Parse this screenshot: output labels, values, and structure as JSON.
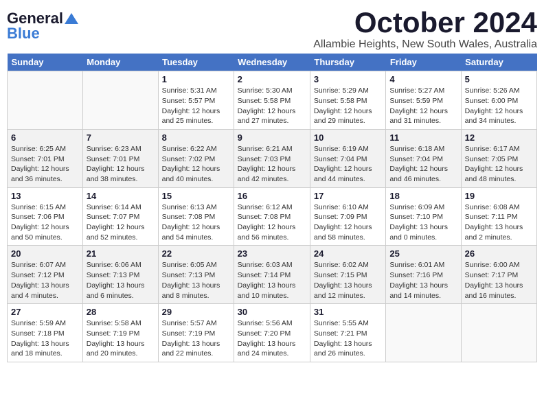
{
  "header": {
    "logo_general": "General",
    "logo_blue": "Blue",
    "month_title": "October 2024",
    "location": "Allambie Heights, New South Wales, Australia"
  },
  "calendar": {
    "days_of_week": [
      "Sunday",
      "Monday",
      "Tuesday",
      "Wednesday",
      "Thursday",
      "Friday",
      "Saturday"
    ],
    "weeks": [
      [
        {
          "day": "",
          "info": ""
        },
        {
          "day": "",
          "info": ""
        },
        {
          "day": "1",
          "info": "Sunrise: 5:31 AM\nSunset: 5:57 PM\nDaylight: 12 hours\nand 25 minutes."
        },
        {
          "day": "2",
          "info": "Sunrise: 5:30 AM\nSunset: 5:58 PM\nDaylight: 12 hours\nand 27 minutes."
        },
        {
          "day": "3",
          "info": "Sunrise: 5:29 AM\nSunset: 5:58 PM\nDaylight: 12 hours\nand 29 minutes."
        },
        {
          "day": "4",
          "info": "Sunrise: 5:27 AM\nSunset: 5:59 PM\nDaylight: 12 hours\nand 31 minutes."
        },
        {
          "day": "5",
          "info": "Sunrise: 5:26 AM\nSunset: 6:00 PM\nDaylight: 12 hours\nand 34 minutes."
        }
      ],
      [
        {
          "day": "6",
          "info": "Sunrise: 6:25 AM\nSunset: 7:01 PM\nDaylight: 12 hours\nand 36 minutes."
        },
        {
          "day": "7",
          "info": "Sunrise: 6:23 AM\nSunset: 7:01 PM\nDaylight: 12 hours\nand 38 minutes."
        },
        {
          "day": "8",
          "info": "Sunrise: 6:22 AM\nSunset: 7:02 PM\nDaylight: 12 hours\nand 40 minutes."
        },
        {
          "day": "9",
          "info": "Sunrise: 6:21 AM\nSunset: 7:03 PM\nDaylight: 12 hours\nand 42 minutes."
        },
        {
          "day": "10",
          "info": "Sunrise: 6:19 AM\nSunset: 7:04 PM\nDaylight: 12 hours\nand 44 minutes."
        },
        {
          "day": "11",
          "info": "Sunrise: 6:18 AM\nSunset: 7:04 PM\nDaylight: 12 hours\nand 46 minutes."
        },
        {
          "day": "12",
          "info": "Sunrise: 6:17 AM\nSunset: 7:05 PM\nDaylight: 12 hours\nand 48 minutes."
        }
      ],
      [
        {
          "day": "13",
          "info": "Sunrise: 6:15 AM\nSunset: 7:06 PM\nDaylight: 12 hours\nand 50 minutes."
        },
        {
          "day": "14",
          "info": "Sunrise: 6:14 AM\nSunset: 7:07 PM\nDaylight: 12 hours\nand 52 minutes."
        },
        {
          "day": "15",
          "info": "Sunrise: 6:13 AM\nSunset: 7:08 PM\nDaylight: 12 hours\nand 54 minutes."
        },
        {
          "day": "16",
          "info": "Sunrise: 6:12 AM\nSunset: 7:08 PM\nDaylight: 12 hours\nand 56 minutes."
        },
        {
          "day": "17",
          "info": "Sunrise: 6:10 AM\nSunset: 7:09 PM\nDaylight: 12 hours\nand 58 minutes."
        },
        {
          "day": "18",
          "info": "Sunrise: 6:09 AM\nSunset: 7:10 PM\nDaylight: 13 hours\nand 0 minutes."
        },
        {
          "day": "19",
          "info": "Sunrise: 6:08 AM\nSunset: 7:11 PM\nDaylight: 13 hours\nand 2 minutes."
        }
      ],
      [
        {
          "day": "20",
          "info": "Sunrise: 6:07 AM\nSunset: 7:12 PM\nDaylight: 13 hours\nand 4 minutes."
        },
        {
          "day": "21",
          "info": "Sunrise: 6:06 AM\nSunset: 7:13 PM\nDaylight: 13 hours\nand 6 minutes."
        },
        {
          "day": "22",
          "info": "Sunrise: 6:05 AM\nSunset: 7:13 PM\nDaylight: 13 hours\nand 8 minutes."
        },
        {
          "day": "23",
          "info": "Sunrise: 6:03 AM\nSunset: 7:14 PM\nDaylight: 13 hours\nand 10 minutes."
        },
        {
          "day": "24",
          "info": "Sunrise: 6:02 AM\nSunset: 7:15 PM\nDaylight: 13 hours\nand 12 minutes."
        },
        {
          "day": "25",
          "info": "Sunrise: 6:01 AM\nSunset: 7:16 PM\nDaylight: 13 hours\nand 14 minutes."
        },
        {
          "day": "26",
          "info": "Sunrise: 6:00 AM\nSunset: 7:17 PM\nDaylight: 13 hours\nand 16 minutes."
        }
      ],
      [
        {
          "day": "27",
          "info": "Sunrise: 5:59 AM\nSunset: 7:18 PM\nDaylight: 13 hours\nand 18 minutes."
        },
        {
          "day": "28",
          "info": "Sunrise: 5:58 AM\nSunset: 7:19 PM\nDaylight: 13 hours\nand 20 minutes."
        },
        {
          "day": "29",
          "info": "Sunrise: 5:57 AM\nSunset: 7:19 PM\nDaylight: 13 hours\nand 22 minutes."
        },
        {
          "day": "30",
          "info": "Sunrise: 5:56 AM\nSunset: 7:20 PM\nDaylight: 13 hours\nand 24 minutes."
        },
        {
          "day": "31",
          "info": "Sunrise: 5:55 AM\nSunset: 7:21 PM\nDaylight: 13 hours\nand 26 minutes."
        },
        {
          "day": "",
          "info": ""
        },
        {
          "day": "",
          "info": ""
        }
      ]
    ]
  }
}
